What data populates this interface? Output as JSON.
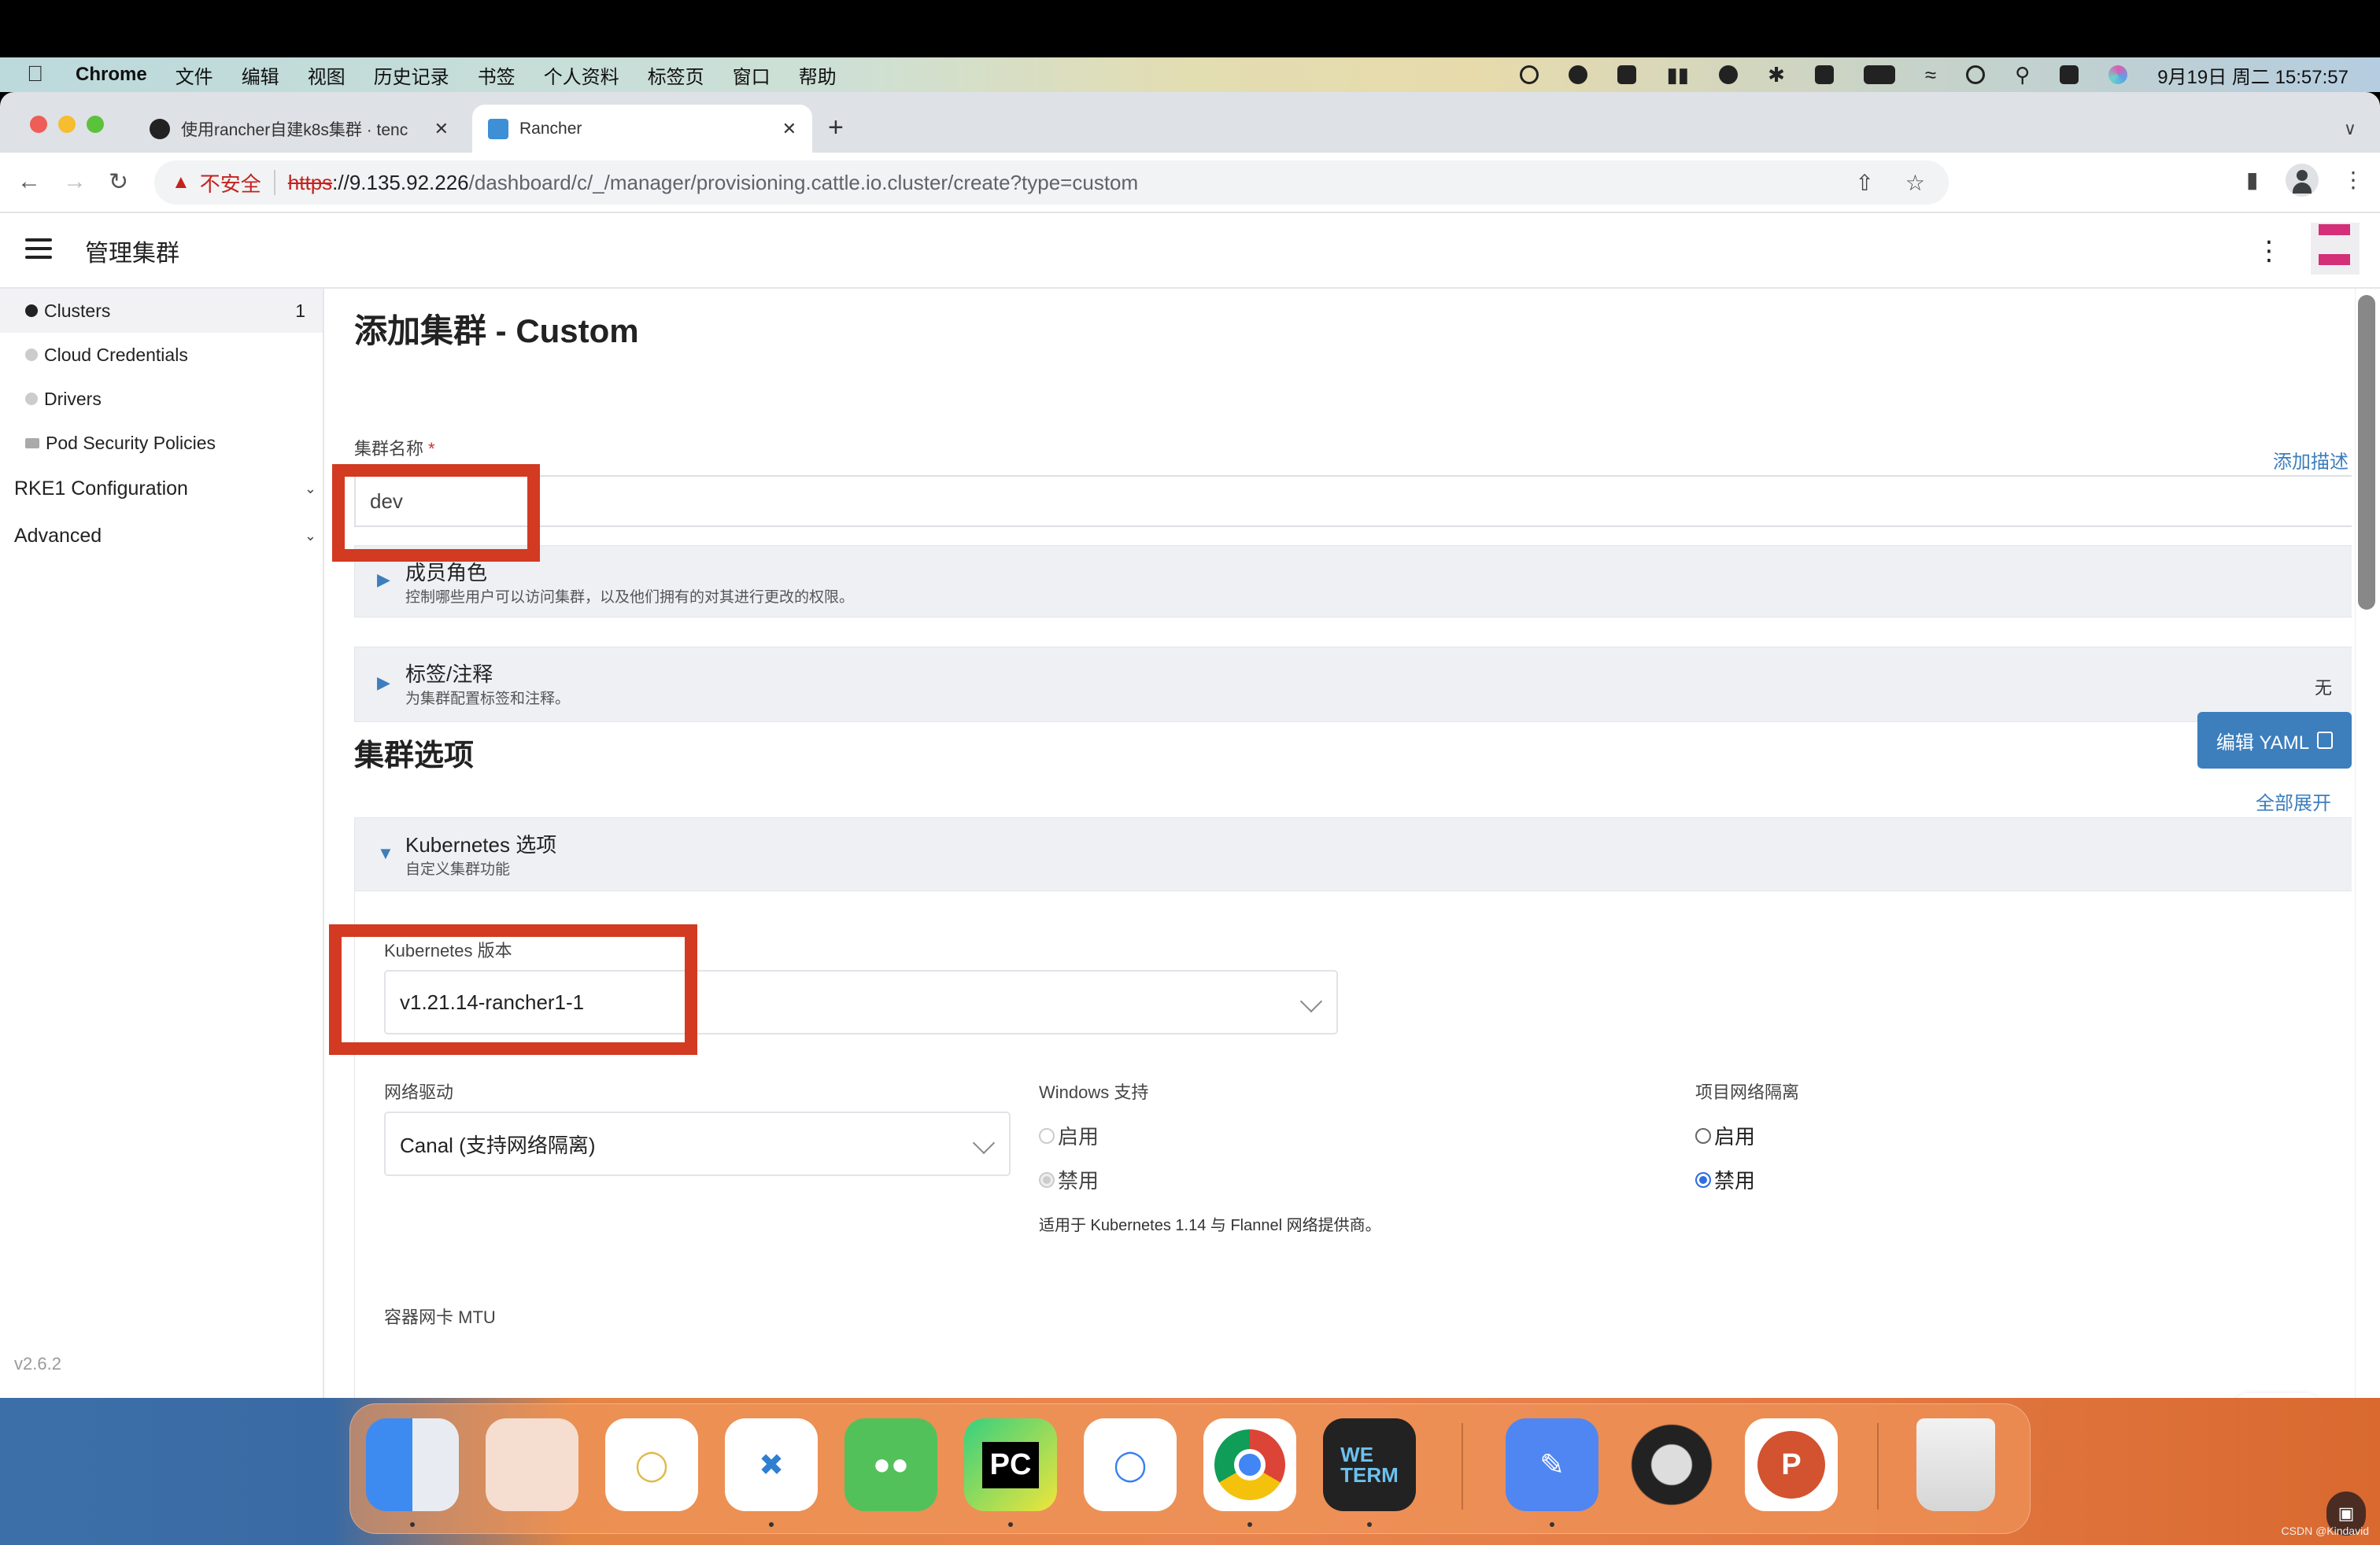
{
  "menubar": {
    "app_name": "Chrome",
    "menus": [
      "文件",
      "编辑",
      "视图",
      "历史记录",
      "书签",
      "个人资料",
      "标签页",
      "窗口",
      "帮助"
    ],
    "datetime": "9月19日 周二 15:57:57"
  },
  "browser": {
    "tabs": [
      {
        "title": "使用rancher自建k8s集群 · tenc",
        "icon": "github-icon",
        "active": false
      },
      {
        "title": "Rancher",
        "icon": "rancher-icon",
        "active": true
      }
    ],
    "new_tab": "+",
    "tab_close": "✕",
    "security_label": "不安全",
    "url_scheme": "https",
    "url_host": "://9.135.92.226",
    "url_path": "/dashboard/c/_/manager/provisioning.cattle.io.cluster/create?type=custom"
  },
  "app": {
    "header_title": "管理集群",
    "sidebar": {
      "items": [
        {
          "label": "Clusters",
          "count": "1",
          "active": true,
          "icon": "globe-icon"
        },
        {
          "label": "Cloud Credentials",
          "count": "",
          "active": false,
          "icon": "globe-icon"
        },
        {
          "label": "Drivers",
          "count": "",
          "active": false,
          "icon": "globe-icon"
        },
        {
          "label": "Pod Security Policies",
          "count": "",
          "active": false,
          "icon": "folder-icon"
        }
      ],
      "groups": [
        {
          "label": "RKE1 Configuration"
        },
        {
          "label": "Advanced"
        }
      ],
      "version": "v2.6.2"
    },
    "page_title": "添加集群 - Custom",
    "cluster_name": {
      "label": "集群名称",
      "required_mark": "*",
      "value": "dev",
      "add_description_link": "添加描述"
    },
    "accordions": [
      {
        "title": "成员角色",
        "subtitle": "控制哪些用户可以访问集群，以及他们拥有的对其进行更改的权限。",
        "right": ""
      },
      {
        "title": "标签/注释",
        "subtitle": "为集群配置标签和注释。",
        "right": "无"
      }
    ],
    "cluster_options": {
      "title": "集群选项",
      "edit_yaml_button": "编辑 YAML",
      "expand_all_link": "全部展开",
      "kubernetes_section": {
        "title": "Kubernetes 选项",
        "subtitle": "自定义集群功能",
        "version_label": "Kubernetes 版本",
        "version_value": "v1.21.14-rancher1-1",
        "network_driver_label": "网络驱动",
        "network_driver_value": "Canal (支持网络隔离)",
        "windows_support": {
          "label": "Windows 支持",
          "options": [
            "启用",
            "禁用"
          ],
          "selected": "禁用",
          "disabled": true,
          "hint": "适用于 Kubernetes 1.14 与 Flannel 网络提供商。"
        },
        "project_network_isolation": {
          "label": "项目网络隔离",
          "options": [
            "启用",
            "禁用"
          ],
          "selected": "禁用"
        },
        "mtu_label": "容器网卡 MTU"
      }
    }
  },
  "dock": {
    "apps": [
      "Finder",
      "Launchpad",
      "Navicat",
      "Visual Studio Code",
      "WeChat",
      "PyCharm",
      "Lark",
      "Google Chrome",
      "WeTerm",
      "Write",
      "Sync",
      "PowerPoint",
      "Trash"
    ]
  },
  "watermark": "CSDN @Kindavid",
  "colors": {
    "accent": "#3d7ebd",
    "annotation_red": "#d23a22",
    "brand_pink": "#d42f79"
  }
}
